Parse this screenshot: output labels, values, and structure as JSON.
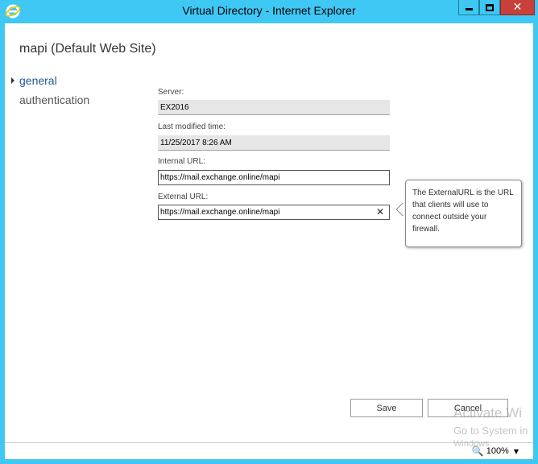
{
  "window": {
    "title": "Virtual Directory - Internet Explorer",
    "close_glyph": "✕"
  },
  "page": {
    "title": "mapi (Default Web Site)"
  },
  "nav": {
    "items": [
      {
        "label": "general",
        "active": true
      },
      {
        "label": "authentication",
        "active": false
      }
    ]
  },
  "form": {
    "server": {
      "label": "Server:",
      "value": "EX2016"
    },
    "last_modified": {
      "label": "Last modified time:",
      "value": "11/25/2017 8:26 AM"
    },
    "internal_url": {
      "label": "Internal URL:",
      "value": "https://mail.exchange.online/mapi"
    },
    "external_url": {
      "label": "External URL:",
      "value": "https://mail.exchange.online/mapi",
      "clear_glyph": "✕"
    }
  },
  "tooltip": {
    "text": "The ExternalURL is the URL that clients will use to connect outside your firewall."
  },
  "buttons": {
    "save": "Save",
    "cancel": "Cancel"
  },
  "watermark": {
    "line1": "Activate Wi",
    "line2": "Go to System in",
    "line3": "Windows."
  },
  "statusbar": {
    "zoom": "100%",
    "zoom_icon": "🔍",
    "caret": "▼"
  }
}
